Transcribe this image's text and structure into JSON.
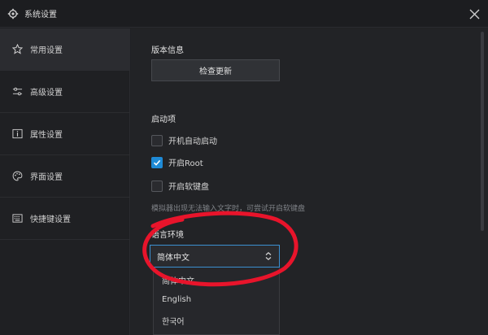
{
  "window": {
    "title": "系统设置",
    "close_icon": "close-icon"
  },
  "sidebar": {
    "items": [
      {
        "label": "常用设置",
        "icon": "star-icon",
        "active": true
      },
      {
        "label": "高级设置",
        "icon": "sliders-icon",
        "active": false
      },
      {
        "label": "属性设置",
        "icon": "info-icon",
        "active": false
      },
      {
        "label": "界面设置",
        "icon": "palette-icon",
        "active": false
      },
      {
        "label": "快捷键设置",
        "icon": "keyboard-icon",
        "active": false
      }
    ]
  },
  "content": {
    "version": {
      "title": "版本信息",
      "check_update_label": "检查更新"
    },
    "startup": {
      "title": "启动项",
      "options": [
        {
          "label": "开机自动启动",
          "checked": false
        },
        {
          "label": "开启Root",
          "checked": true
        },
        {
          "label": "开启软键盘",
          "checked": false
        }
      ],
      "hint": "模拟器出现无法输入文字时，可尝试开启软键盘"
    },
    "language": {
      "title": "语言环境",
      "selected": "简体中文",
      "options": [
        "简体中文",
        "English",
        "한국어"
      ]
    }
  },
  "colors": {
    "accent": "#1e8ad6",
    "annotation": "#e8142b"
  }
}
